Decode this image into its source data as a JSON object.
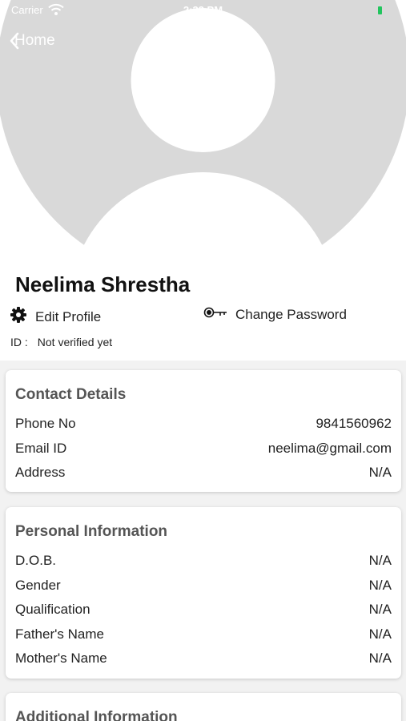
{
  "status_bar": {
    "carrier": "Carrier",
    "time": "2:33 PM"
  },
  "nav": {
    "back_label": "Home"
  },
  "profile": {
    "name": "Neelima Shrestha",
    "edit_label": "Edit Profile",
    "change_password_label": "Change Password",
    "id_label": "ID :",
    "id_value": "Not verified yet"
  },
  "contact": {
    "title": "Contact Details",
    "rows": [
      {
        "label": "Phone No",
        "value": "9841560962"
      },
      {
        "label": "Email ID",
        "value": "neelima@gmail.com"
      },
      {
        "label": "Address",
        "value": "N/A"
      }
    ]
  },
  "personal": {
    "title": "Personal Information",
    "rows": [
      {
        "label": "D.O.B.",
        "value": "N/A"
      },
      {
        "label": "Gender",
        "value": "N/A"
      },
      {
        "label": "Qualification",
        "value": "N/A"
      },
      {
        "label": "Father's Name",
        "value": "N/A"
      },
      {
        "label": "Mother's Name",
        "value": "N/A"
      }
    ]
  },
  "additional": {
    "title": "Additional Information"
  },
  "colors": {
    "avatar_bg": "#d9d9d9",
    "accent": "#22c55e",
    "card_title": "#555555"
  }
}
